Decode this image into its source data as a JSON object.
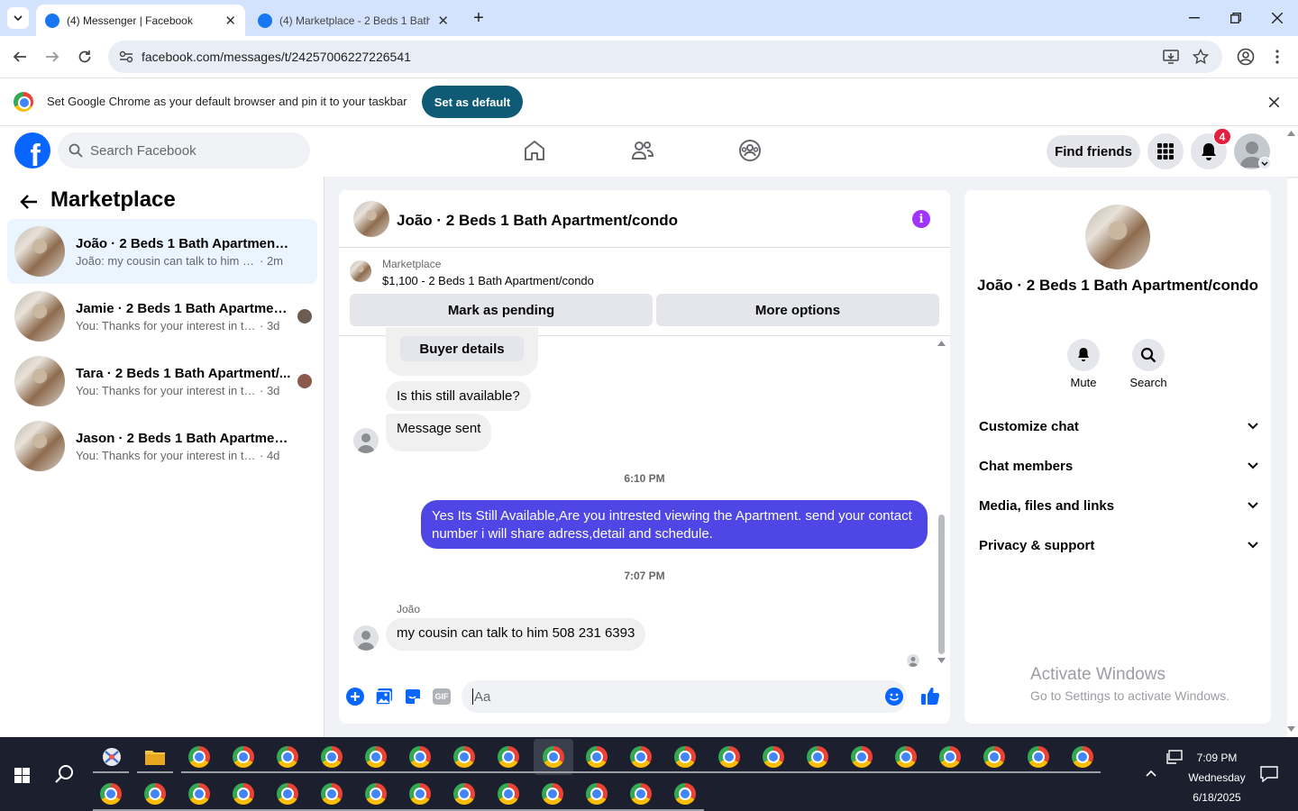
{
  "browser": {
    "tabs": [
      {
        "title": "(4) Messenger | Facebook"
      },
      {
        "title": "(4) Marketplace - 2 Beds 1 Bath"
      }
    ],
    "url": "facebook.com/messages/t/24257006227226541",
    "infobar_text": "Set Google Chrome as your default browser and pin it to your taskbar",
    "set_default_label": "Set as default"
  },
  "fbnav": {
    "search_placeholder": "Search Facebook",
    "find_friends_label": "Find friends",
    "notification_count": "4"
  },
  "left_panel": {
    "title": "Marketplace",
    "conversations": [
      {
        "name": "João · 2 Beds 1 Bath Apartment/co...",
        "preview": "João: my cousin can talk to him 508 ...",
        "time": "· 2m"
      },
      {
        "name": "Jamie · 2 Beds 1 Bath Apartment...",
        "preview": "You: Thanks for your interest in the...",
        "time": "· 3d"
      },
      {
        "name": "Tara · 2 Beds 1 Bath Apartment/...",
        "preview": "You: Thanks for your interest in the...",
        "time": "· 3d"
      },
      {
        "name": "Jason · 2 Beds 1 Bath Apartment/c...",
        "preview": "You: Thanks for your interest in the ho...",
        "time": "· 4d"
      }
    ]
  },
  "chat": {
    "title": "João · 2 Beds 1 Bath Apartment/condo",
    "marketplace_label": "Marketplace",
    "listing": "$1,100 - 2 Beds 1 Bath Apartment/condo",
    "mark_pending_label": "Mark as pending",
    "more_options_label": "More options",
    "buyer_details_label": "Buyer details",
    "messages": {
      "m1": "Is this still available?",
      "m2": "Message sent",
      "time1": "6:10 PM",
      "out1": "Yes Its Still Available,Are you intrested viewing the Apartment. send your contact number i will share adress,detail and schedule.",
      "time2": "7:07 PM",
      "sender": "João",
      "m3": "my cousin can talk to him 508 231 6393"
    },
    "composer_placeholder": "Aa"
  },
  "right_panel": {
    "name": "João · 2 Beds 1 Bath Apartment/condo",
    "mute_label": "Mute",
    "search_label": "Search",
    "sections": [
      "Customize chat",
      "Chat members",
      "Media, files and links",
      "Privacy & support"
    ]
  },
  "watermark": {
    "line1": "Activate Windows",
    "line2": "Go to Settings to activate Windows."
  },
  "taskbar": {
    "time": "7:09 PM",
    "day": "Wednesday",
    "date": "6/18/2025"
  },
  "colors": {
    "fb_blue": "#0866ff",
    "outgoing_bubble": "#4e46e5",
    "badge_red": "#e41e3f"
  }
}
